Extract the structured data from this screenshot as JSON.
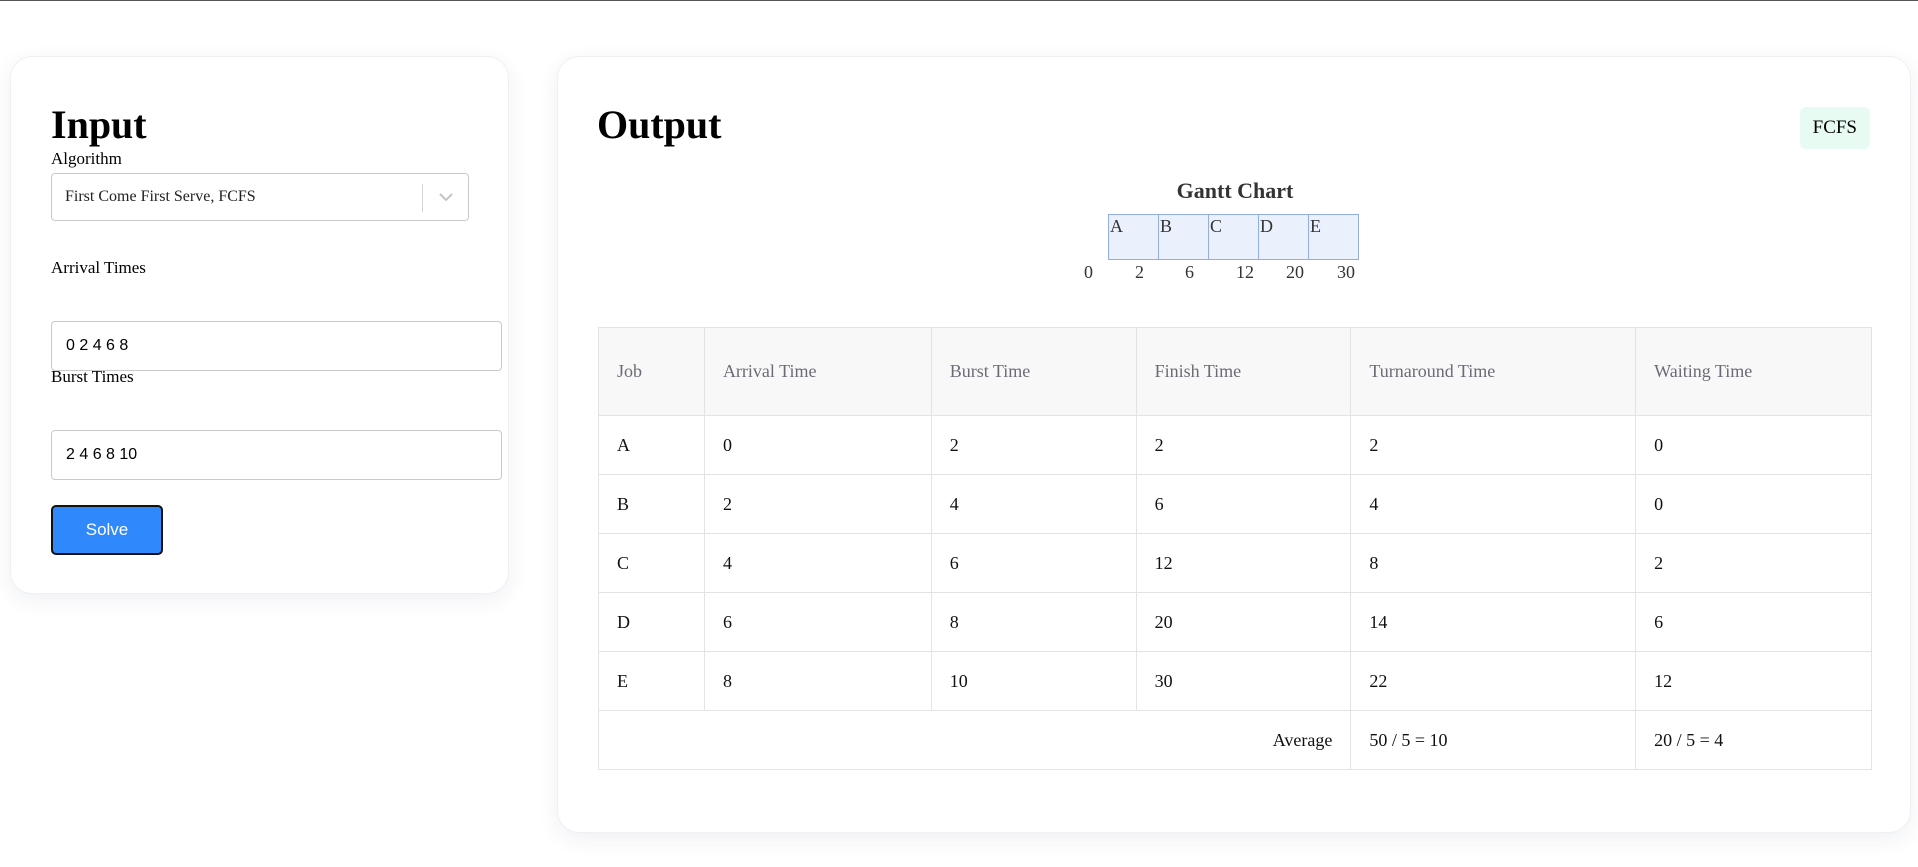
{
  "input": {
    "title": "Input",
    "algorithm_label": "Algorithm",
    "algorithm_value": "First Come First Serve, FCFS",
    "arrival_label": "Arrival Times",
    "arrival_value": "0 2 4 6 8",
    "burst_label": "Burst Times",
    "burst_value": "2 4 6 8 10",
    "solve_label": "Solve"
  },
  "output": {
    "title": "Output",
    "badge": "FCFS",
    "gantt": {
      "title": "Gantt Chart",
      "jobs": [
        "A",
        "B",
        "C",
        "D",
        "E"
      ],
      "ticks": [
        "0",
        "2",
        "6",
        "12",
        "20",
        "30"
      ]
    },
    "table": {
      "headers": [
        "Job",
        "Arrival Time",
        "Burst Time",
        "Finish Time",
        "Turnaround Time",
        "Waiting Time"
      ],
      "rows": [
        [
          "A",
          "0",
          "2",
          "2",
          "2",
          "0"
        ],
        [
          "B",
          "2",
          "4",
          "6",
          "4",
          "0"
        ],
        [
          "C",
          "4",
          "6",
          "12",
          "8",
          "2"
        ],
        [
          "D",
          "6",
          "8",
          "20",
          "14",
          "6"
        ],
        [
          "E",
          "8",
          "10",
          "30",
          "22",
          "12"
        ]
      ],
      "average_label": "Average",
      "average_turnaround": "50 / 5 = 10",
      "average_waiting": "20 / 5 = 4"
    }
  },
  "colors": {
    "solve_button": "#2f89fc",
    "badge_bg": "#e8fbf3",
    "gantt_fill": "#eaf1fd",
    "gantt_border": "#94aee3"
  },
  "icons": {
    "select_chevron": "chevron-down-icon"
  }
}
